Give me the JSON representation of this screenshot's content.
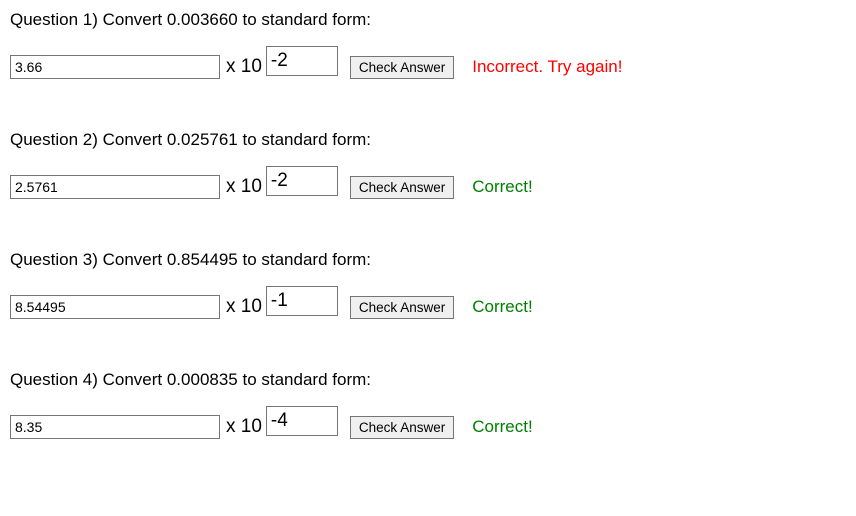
{
  "labels": {
    "times_ten": "x 10",
    "check_button": "Check Answer"
  },
  "feedback_text": {
    "correct": "Correct!",
    "incorrect": "Incorrect. Try again!"
  },
  "questions": [
    {
      "prompt": "Question 1) Convert 0.003660 to standard form:",
      "mantissa_value": "3.66",
      "exponent_value": "-2",
      "status": "incorrect"
    },
    {
      "prompt": "Question 2) Convert 0.025761 to standard form:",
      "mantissa_value": "2.5761",
      "exponent_value": "-2",
      "status": "correct"
    },
    {
      "prompt": "Question 3) Convert 0.854495 to standard form:",
      "mantissa_value": "8.54495",
      "exponent_value": "-1",
      "status": "correct"
    },
    {
      "prompt": "Question 4) Convert 0.000835 to standard form:",
      "mantissa_value": "8.35",
      "exponent_value": "-4",
      "status": "correct"
    }
  ]
}
